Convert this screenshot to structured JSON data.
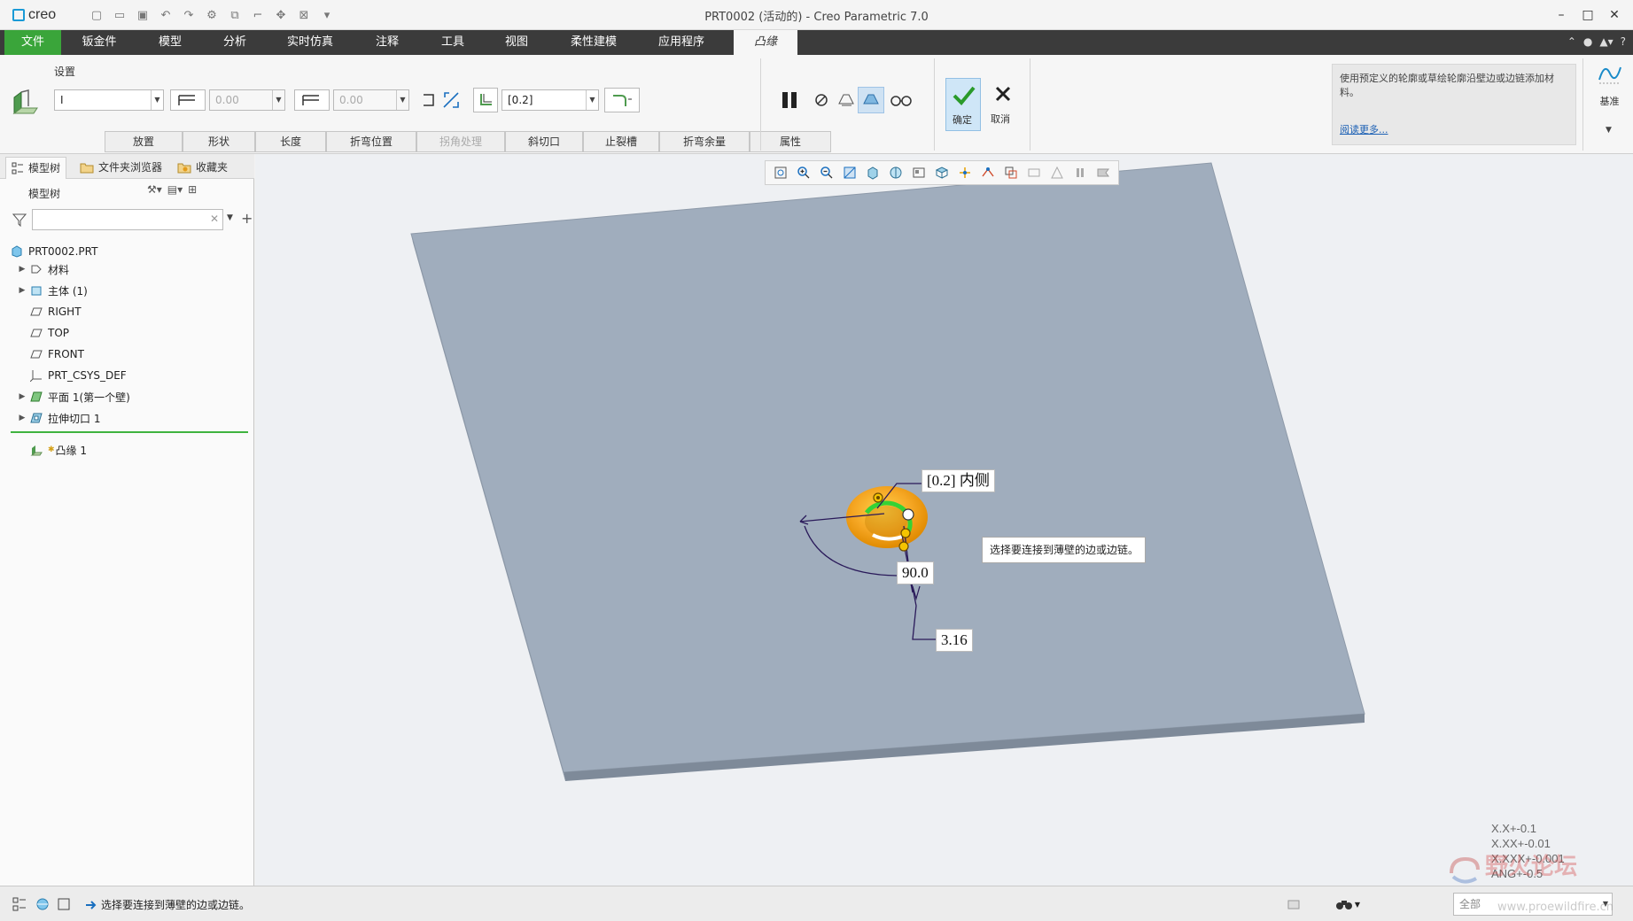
{
  "app": {
    "logo_text": "creo",
    "window_title": "PRT0002 (活动的) - Creo Parametric 7.0"
  },
  "ribbon_tabs": [
    {
      "label": "文件"
    },
    {
      "label": "钣金件"
    },
    {
      "label": "模型"
    },
    {
      "label": "分析"
    },
    {
      "label": "实时仿真"
    },
    {
      "label": "注释"
    },
    {
      "label": "工具"
    },
    {
      "label": "视图"
    },
    {
      "label": "柔性建模"
    },
    {
      "label": "应用程序"
    },
    {
      "label": "凸缘"
    }
  ],
  "ribbon": {
    "settings_label": "设置",
    "shape_value": "I",
    "length1_value": "0.00",
    "length2_value": "0.00",
    "thickness_value": "[0.2]",
    "subtabs": [
      {
        "label": "放置"
      },
      {
        "label": "形状"
      },
      {
        "label": "长度"
      },
      {
        "label": "折弯位置"
      },
      {
        "label": "拐角处理"
      },
      {
        "label": "斜切口"
      },
      {
        "label": "止裂槽"
      },
      {
        "label": "折弯余量"
      },
      {
        "label": "属性"
      }
    ],
    "ok_label": "确定",
    "cancel_label": "取消",
    "help_text": "使用预定义的轮廓或草绘轮廓沿壁边或边链添加材料。",
    "help_link": "阅读更多...",
    "datum_label": "基准"
  },
  "left_panel": {
    "tabs": [
      {
        "label": "模型树"
      },
      {
        "label": "文件夹浏览器"
      },
      {
        "label": "收藏夹"
      }
    ],
    "tree_header": "模型树",
    "tree_items": [
      {
        "label": "PRT0002.PRT"
      },
      {
        "label": "材料"
      },
      {
        "label": "主体 (1)"
      },
      {
        "label": "RIGHT"
      },
      {
        "label": "TOP"
      },
      {
        "label": "FRONT"
      },
      {
        "label": "PRT_CSYS_DEF"
      },
      {
        "label": "平面 1(第一个壁)"
      },
      {
        "label": "拉伸切口 1"
      },
      {
        "label": "凸缘 1"
      }
    ]
  },
  "viewport": {
    "dim_thickness": "[0.2] 内侧",
    "dim_angle": "90.0",
    "dim_length": "3.16",
    "tooltip": "选择要连接到薄壁的边或边链。",
    "tolerances": [
      "X.X+-0.1",
      "X.XX+-0.01",
      "X.XXX+-0.001",
      "ANG+-0.5"
    ],
    "watermark": "野火论坛",
    "watermark_url": "www.proewildfire.cn"
  },
  "status": {
    "message": "选择要连接到薄壁的边或边链。",
    "filter_value": "全部"
  }
}
